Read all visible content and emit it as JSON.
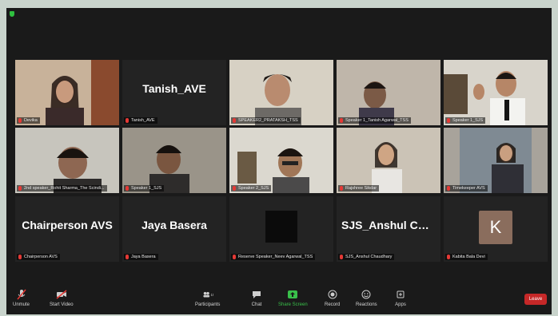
{
  "window": {
    "status_text": ""
  },
  "participants": [
    {
      "name": "Devika",
      "video": true,
      "muted": true
    },
    {
      "name": "Tanish_AVE",
      "video": false,
      "muted": true,
      "display_name": "Tanish_AVE"
    },
    {
      "name": "SPEAKER2_PRATAKSH_TSS",
      "video": true,
      "muted": true
    },
    {
      "name": "Speaker 1_Tanish Agarwal_TSS",
      "video": true,
      "muted": true
    },
    {
      "name": "Speaker 1_SJS",
      "video": true,
      "muted": true,
      "active": true
    },
    {
      "name": "2nd speaker_Rohit Sharma_The Scindi...",
      "video": true,
      "muted": true
    },
    {
      "name": "Speaker 1_SJS",
      "video": true,
      "muted": true
    },
    {
      "name": "Speaker 2_SJS",
      "video": true,
      "muted": true
    },
    {
      "name": "Rajshree Sikdar",
      "video": true,
      "muted": true
    },
    {
      "name": "Timekeeper AVS",
      "video": true,
      "muted": true
    },
    {
      "name": "Chairperson AVS",
      "video": false,
      "muted": true,
      "display_name": "Chairperson AVS"
    },
    {
      "name": "Jaya Basera",
      "video": false,
      "muted": true,
      "display_name": "Jaya Basera"
    },
    {
      "name": "Reserve Speaker_Neev Agarwal_TSS",
      "video": false,
      "muted": true,
      "display_name": ""
    },
    {
      "name": "SJS_Anshul Chaudhary",
      "video": false,
      "muted": true,
      "display_name": "SJS_Anshul Chou..."
    },
    {
      "name": "Kabita Bala Devi",
      "video": false,
      "muted": true,
      "avatar_letter": "K"
    }
  ],
  "toolbar": {
    "unmute": "Unmute",
    "start_video": "Start Video",
    "participants": "Participants",
    "participants_count": "15",
    "chat": "Chat",
    "share_screen": "Share Screen",
    "record": "Record",
    "reactions": "Reactions",
    "apps": "Apps",
    "leave": "Leave"
  },
  "colors": {
    "active_border": "#c6d24a",
    "share": "#39c04a",
    "leave": "#c62828",
    "muted_mic": "#e53935"
  }
}
